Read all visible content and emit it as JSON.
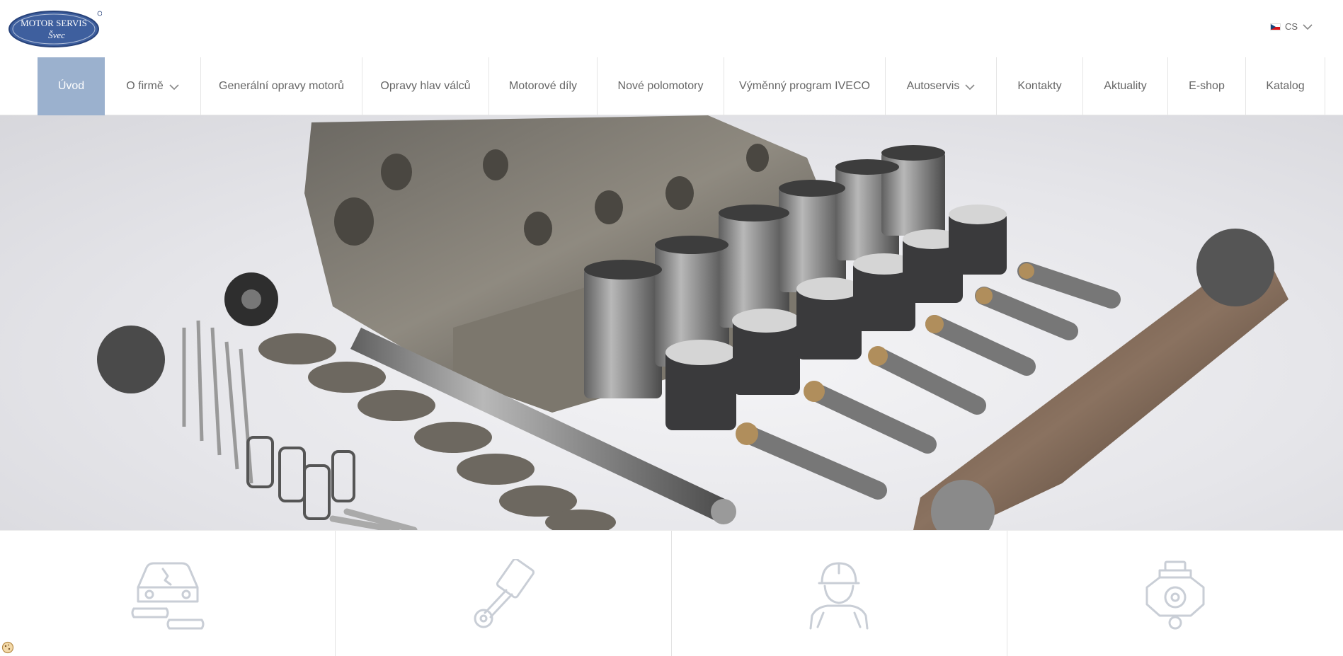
{
  "logo": {
    "line1": "MOTOR SERVIS",
    "line2": "Švec"
  },
  "language": {
    "code": "CS",
    "flag": "cz-flag-icon"
  },
  "nav": {
    "items": [
      {
        "label": "Úvod",
        "active": true,
        "dropdown": false
      },
      {
        "label": "O firmě",
        "active": false,
        "dropdown": true
      },
      {
        "label": "Generální opravy motorů",
        "active": false,
        "dropdown": false
      },
      {
        "label": "Opravy hlav válců",
        "active": false,
        "dropdown": false
      },
      {
        "label": "Motorové díly",
        "active": false,
        "dropdown": false
      },
      {
        "label": "Nové polomotory",
        "active": false,
        "dropdown": false
      },
      {
        "label": "Výměnný program IVECO",
        "active": false,
        "dropdown": false
      },
      {
        "label": "Autoservis",
        "active": false,
        "dropdown": true
      },
      {
        "label": "Kontakty",
        "active": false,
        "dropdown": false
      },
      {
        "label": "Aktuality",
        "active": false,
        "dropdown": false
      },
      {
        "label": "E-shop",
        "active": false,
        "dropdown": false
      },
      {
        "label": "Katalog",
        "active": false,
        "dropdown": false
      }
    ]
  },
  "hero": {
    "image": "engine-parts-photo"
  },
  "tiles": [
    {
      "icon": "car-repair-icon"
    },
    {
      "icon": "piston-icon"
    },
    {
      "icon": "mechanic-icon"
    },
    {
      "icon": "engine-icon"
    }
  ],
  "colors": {
    "accent": "#9bb1ce",
    "icon": "#c9ced6",
    "logo_blue": "#2f4f8f"
  },
  "cookie": {
    "icon": "cookie-icon"
  }
}
